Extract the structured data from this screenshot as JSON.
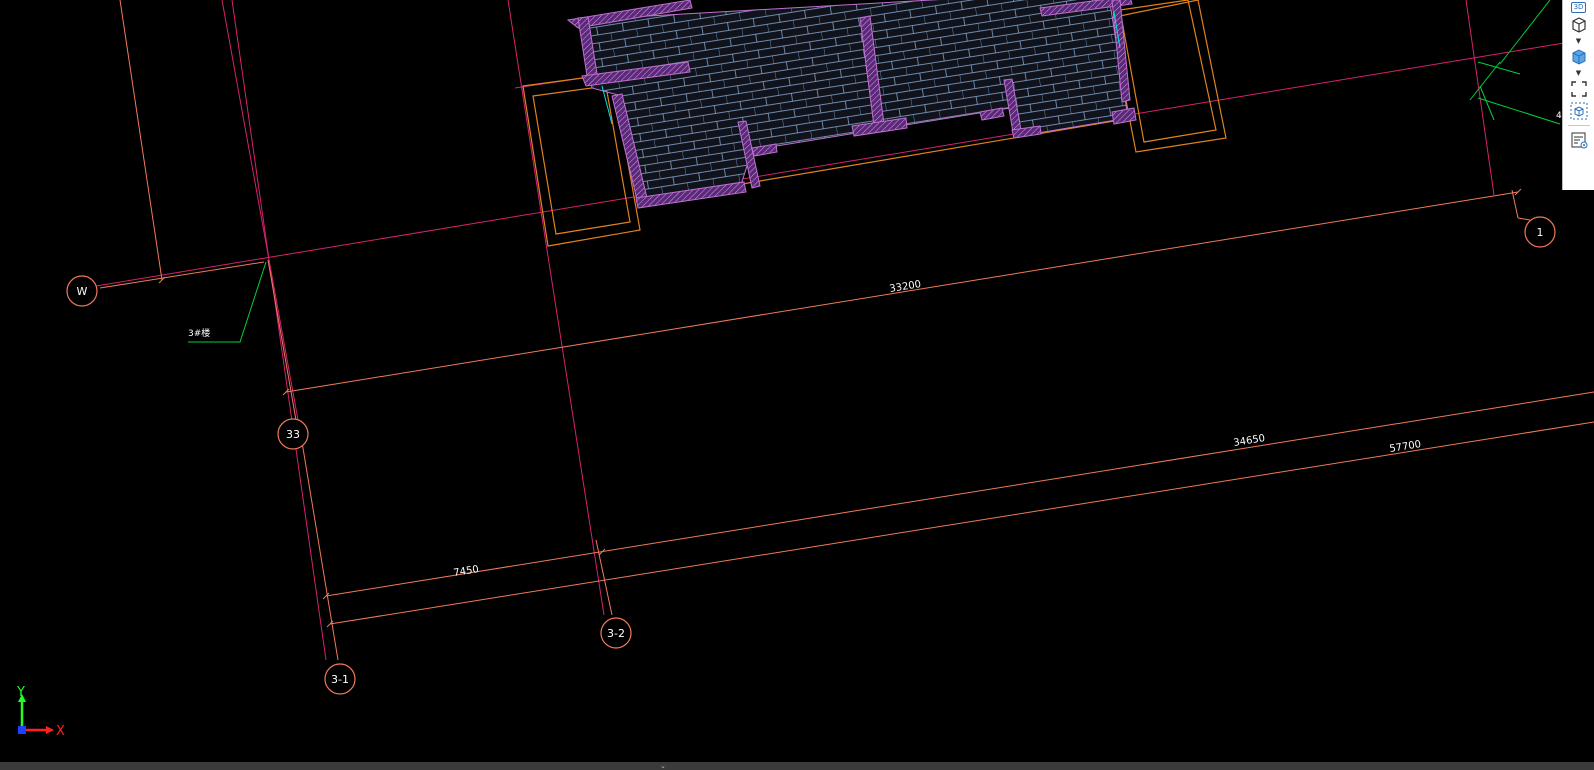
{
  "canvas": {
    "background": "#000000",
    "colors": {
      "grid_line": "#d6216e",
      "dimension_line": "#f07a5a",
      "bubble": "#f07a5a",
      "wall_outline": "#c070d0",
      "wall_fill": "#8a3fb0",
      "brick_pattern": "#8fb0d8",
      "footprint": "#e0821e",
      "leader": "#00d23a",
      "cyan_edge": "#00e6e6"
    }
  },
  "axes": {
    "row_w": "W",
    "col_33": "33",
    "col_3_1": "3-1",
    "col_3_2": "3-2",
    "col_1": "1"
  },
  "dimensions": {
    "d33200": "33200",
    "d34650": "34650",
    "d57700": "57700",
    "d7450": "7450"
  },
  "leaders": {
    "building_label": "3#楼",
    "right_label": "4"
  },
  "toolbar": {
    "badge_3d": "3D",
    "caret": "▼",
    "items": [
      "view-3d",
      "view-cube",
      "solid-cube",
      "fullscreen",
      "isometric-view",
      "properties-list"
    ]
  },
  "ucs": {
    "x_label": "X",
    "y_label": "Y",
    "x_color": "#ff2020",
    "y_color": "#20ff20",
    "origin_color": "#2040ff"
  },
  "bottombar": {
    "handle": "⌄"
  }
}
